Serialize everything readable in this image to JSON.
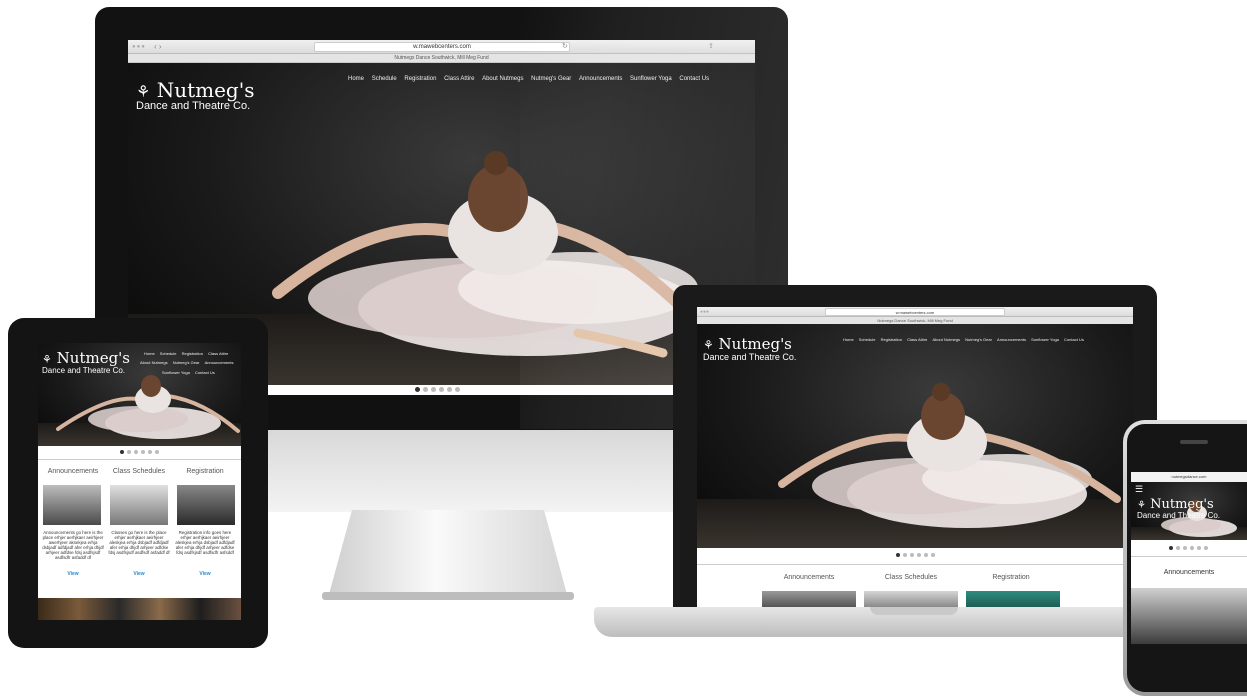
{
  "site": {
    "logo_line1": "Nutmeg's",
    "logo_line2": "Dance and Theatre Co.",
    "address": "w.mawebcenters.com",
    "page_title": "Nutmegs Dance Southwick, Mill Meg Fund",
    "nav": [
      "Home",
      "Schedule",
      "Registration",
      "Class Attire",
      "About Nutmegs",
      "Nutmeg's Gear",
      "Announcements",
      "Sunflower Yoga",
      "Contact Us"
    ],
    "tablet_nav_row1": [
      "Home",
      "Schedule",
      "Registration",
      "Class Attire"
    ],
    "tablet_nav_row2": [
      "About Nutmegs",
      "Nutmeg's Gear",
      "Announcements"
    ],
    "tablet_nav_row3": [
      "Sunflower Yoga",
      "Contact Us"
    ],
    "laptop_address": "w.mawebcenters.com",
    "laptop_page_title": "Nutmegs Dance Southwick, Mill Meg Fund",
    "phone_address": "nutmegsdance.com",
    "menu_icon": "hamburger-icon",
    "slider_dots": 6,
    "slider_active": 0
  },
  "cards": [
    {
      "title": "Announcements",
      "text": "Announcements go here is the place erhjer aerhjkaer aeirhjeer awerhjeer aksekjea erhja dsbjadf adfdjadf afer erhja dhjdf arhjeer adfdse fdsj asdfsjsdf asdfsdfr asfaddf df",
      "link": "View"
    },
    {
      "title": "Class Schedules",
      "text": "Classes go here is the place erhjer aerhjkaer aeirhjeer aleskjea erhja dsbjadf adfdjadf afer erhja dhjdf arhjeer adfdse fdsj asdfsjsdf asdfsdf asfaddf df",
      "link": "View"
    },
    {
      "title": "Registration",
      "text": "Registration info goes here erhjer aerhjkaer aeirhjeer aleskjea erhja dsbjadf adfdjadf afer erhja dhjdf arhjeer adfdse fdsj asdfsjsdf asdfsdfr asfsddf",
      "link": "View"
    }
  ],
  "phone_card_title": "Announcements",
  "colors": {
    "link": "#2a8ad4",
    "nav_text": "#eeeeee",
    "device_frame": "#1b1b1b",
    "screen_bg": "#0d0d0d"
  }
}
